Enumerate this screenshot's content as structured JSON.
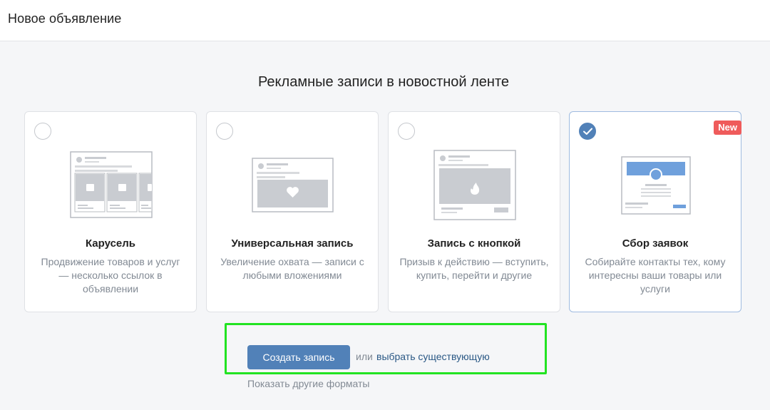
{
  "header": {
    "title": "Новое объявление"
  },
  "section": {
    "title": "Рекламные записи в новостной ленте"
  },
  "cards": [
    {
      "title": "Карусель",
      "desc": "Продвижение товаров и услуг — несколько ссылок в объявлении",
      "selected": false,
      "icon": "carousel-illustration"
    },
    {
      "title": "Универсальная запись",
      "desc": "Увеличение охвата — записи с любыми вложениями",
      "selected": false,
      "icon": "universal-post-illustration"
    },
    {
      "title": "Запись с кнопкой",
      "desc": "Призыв к действию — вступить, купить, перейти и другие",
      "selected": false,
      "icon": "button-post-illustration"
    },
    {
      "title": "Сбор заявок",
      "desc": "Собирайте контакты тех, кому интересны ваши товары или услуги",
      "selected": true,
      "badge": "New",
      "icon": "lead-form-illustration"
    }
  ],
  "actions": {
    "create_label": "Создать запись",
    "or_text": "или",
    "choose_existing": "выбрать существующую",
    "more_formats": "Показать другие форматы"
  },
  "colors": {
    "accent": "#5181b8",
    "link": "#2a5885",
    "badge": "#ef5b5b",
    "highlight": "#22e322",
    "muted_text": "#828a94"
  }
}
